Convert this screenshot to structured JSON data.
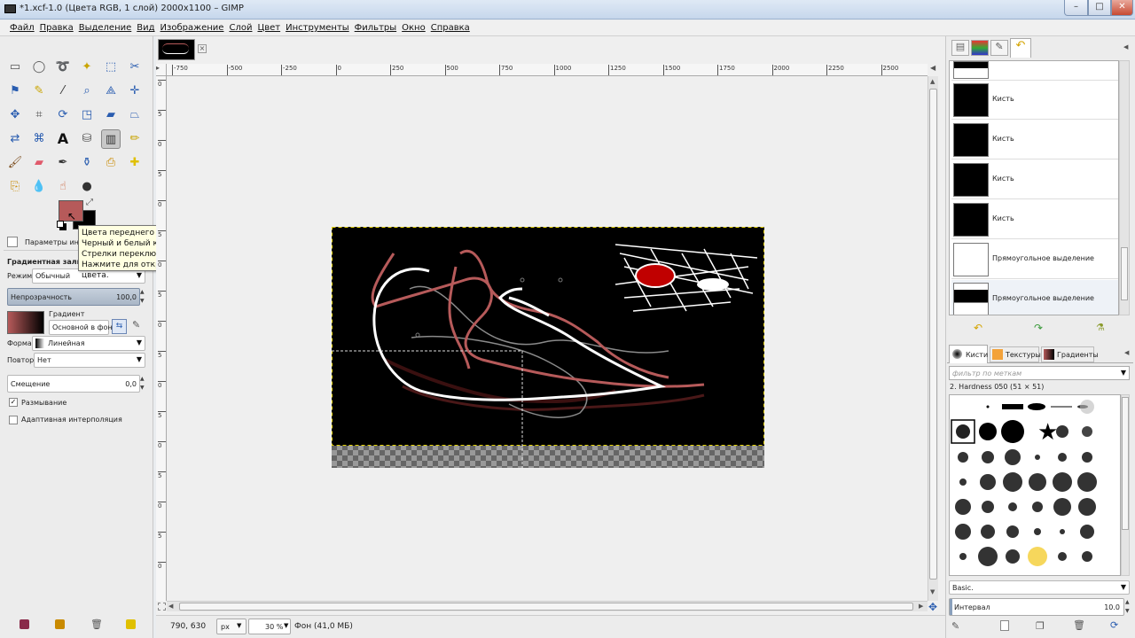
{
  "window": {
    "title": "*1.xcf-1.0 (Цвета RGB, 1 слой) 2000x1100 – GIMP",
    "minimize": "–",
    "maximize": "□",
    "close": "✕"
  },
  "menu": [
    "Файл",
    "Правка",
    "Выделение",
    "Вид",
    "Изображение",
    "Слой",
    "Цвет",
    "Инструменты",
    "Фильтры",
    "Окно",
    "Справка"
  ],
  "tool_options": {
    "header": "Параметры инструментов",
    "title": "Градиентная заливка",
    "mode_label": "Режим:",
    "mode_value": "Обычный",
    "opacity_label": "Непрозрачность",
    "opacity_value": "100,0",
    "gradient_label": "Градиент",
    "gradient_value": "Основной в фон",
    "shape_label": "Форма:",
    "shape_value": "Линейная",
    "repeat_label": "Повтор:",
    "repeat_value": "Нет",
    "offset_label": "Смещение",
    "offset_value": "0,0",
    "dither_label": "Размывание",
    "dither_checked": true,
    "adaptive_label": "Адаптивная интерполяция",
    "adaptive_checked": false
  },
  "colors": {
    "foreground": "#b65a5a",
    "background": "#000000"
  },
  "tooltip": {
    "line1": "Цвета переднего плана и фона.",
    "line2": "Черный и белый квадраты сбрасывают цвета.",
    "line3": "Стрелки переключают цвета.",
    "line4": "Нажмите для открытия диалогового окна выбора цвета."
  },
  "ruler": {
    "h_labels": [
      "-750",
      "-500",
      "-250",
      "0",
      "250",
      "500",
      "750",
      "1000",
      "1250",
      "1500",
      "1750",
      "2000",
      "2250",
      "2500"
    ],
    "v_labels": [
      "0",
      "5",
      "0",
      "5",
      "0",
      "5",
      "0",
      "5",
      "0",
      "5",
      "0",
      "5",
      "0",
      "5",
      "0",
      "5",
      "0"
    ]
  },
  "status": {
    "coords": "790, 630",
    "unit": "px",
    "zoom": "30 %",
    "layer_info": "Фон (41,0 МБ)"
  },
  "history": {
    "items": [
      "Кисть",
      "Кисть",
      "Кисть",
      "Кисть",
      "Прямоугольное выделение",
      "Прямоугольное выделение"
    ]
  },
  "brushes": {
    "tabs": [
      "Кисти",
      "Текстуры",
      "Градиенты"
    ],
    "filter_placeholder": "фильтр по меткам",
    "selected": "2. Hardness 050 (51 × 51)",
    "preset": "Basic.",
    "spacing_label": "Интервал",
    "spacing_value": "10.0"
  }
}
